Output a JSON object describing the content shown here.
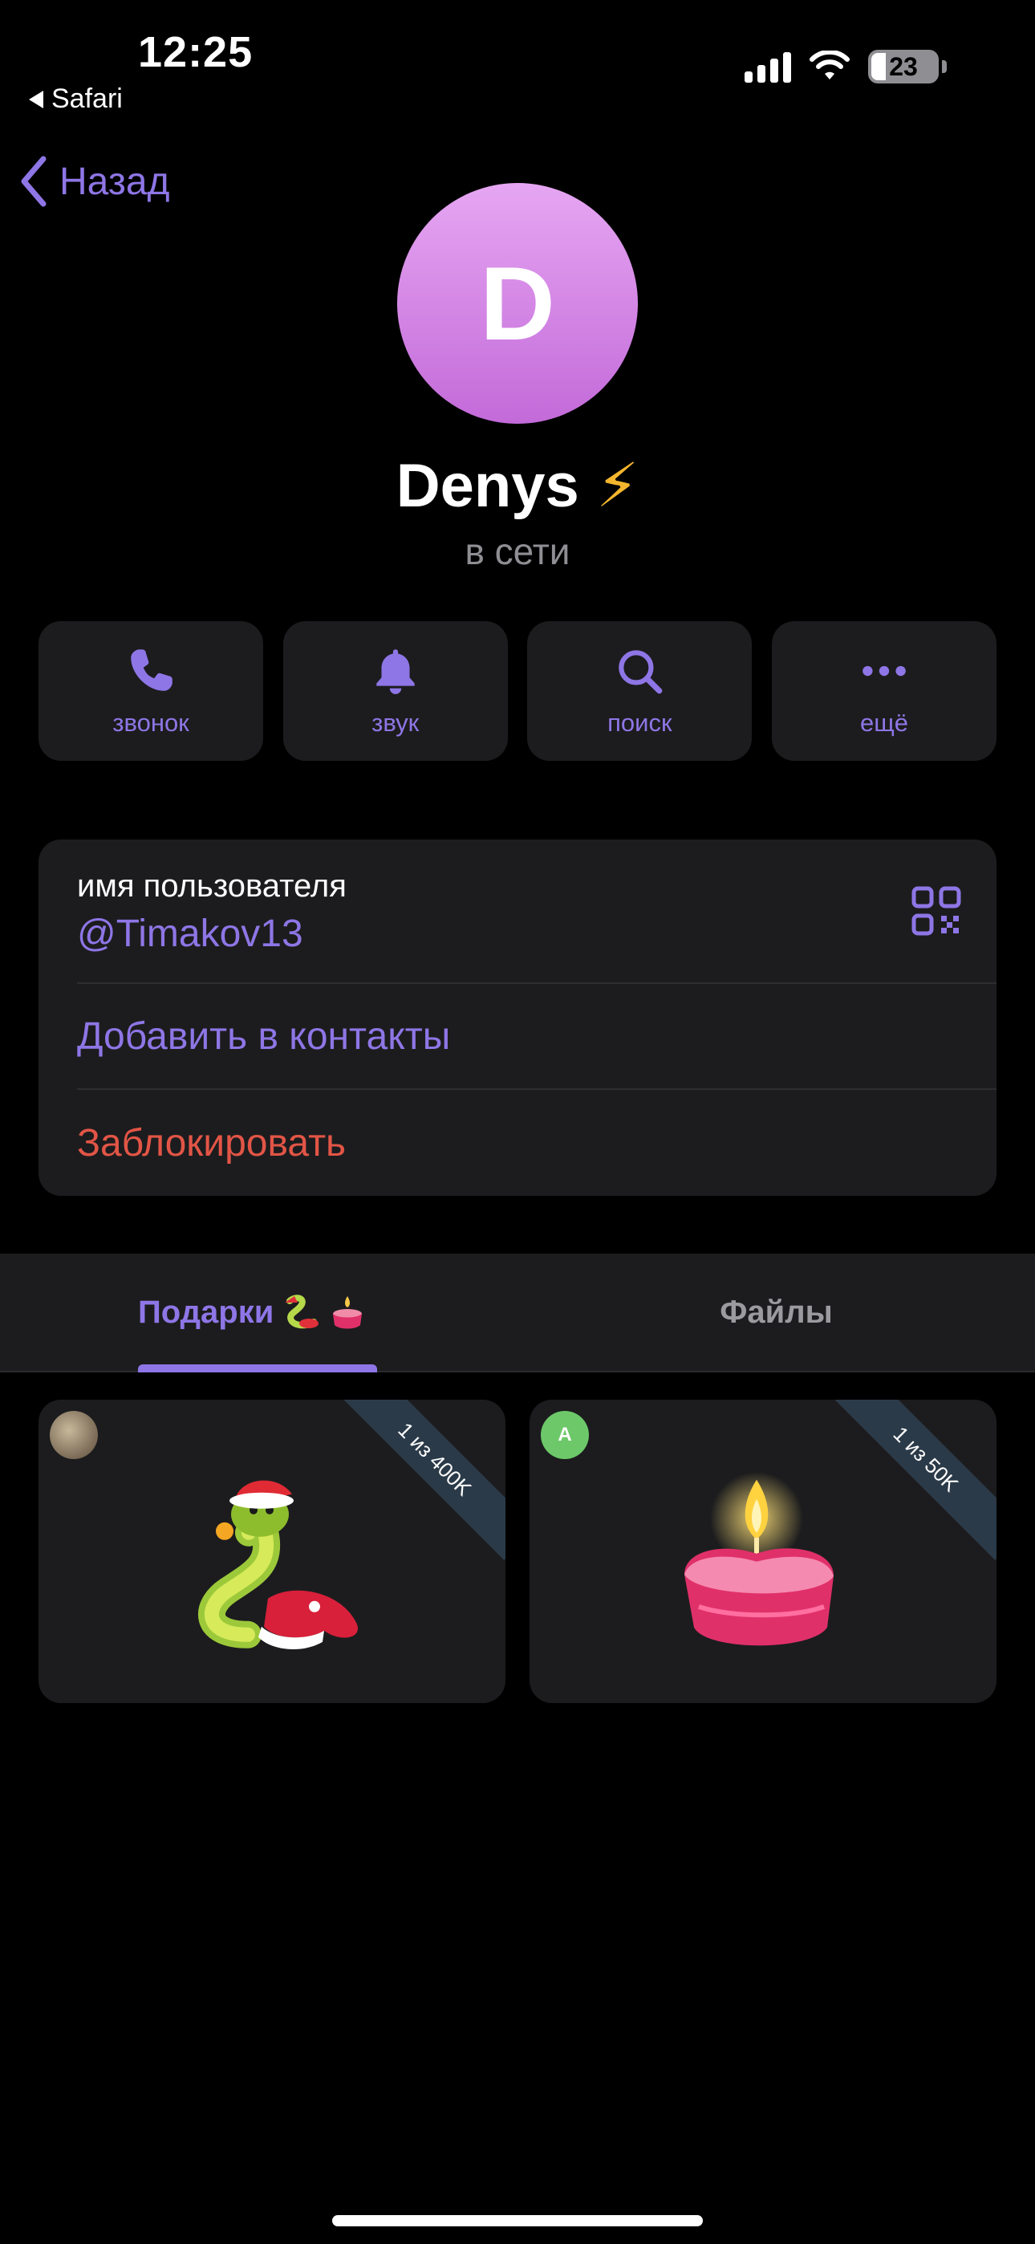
{
  "status_bar": {
    "time": "12:25",
    "back_app": "Safari",
    "battery": "23"
  },
  "nav": {
    "back_label": "Назад"
  },
  "profile": {
    "avatar_letter": "D",
    "name": "Denys",
    "name_emoji": "⚡",
    "status": "в сети",
    "avatar_gradient": [
      "#e6a6f2",
      "#c36ad9"
    ]
  },
  "actions": [
    {
      "label": "звонок",
      "icon": "phone-icon"
    },
    {
      "label": "звук",
      "icon": "bell-icon"
    },
    {
      "label": "поиск",
      "icon": "search-icon"
    },
    {
      "label": "ещё",
      "icon": "more-icon"
    }
  ],
  "info": {
    "username_title": "имя пользователя",
    "username": "@Timakov13",
    "add_contact": "Добавить в контакты",
    "block": "Заблокировать"
  },
  "tabs": {
    "gifts": "Подарки",
    "files": "Файлы"
  },
  "gifts": [
    {
      "ribbon": "1 из 400K",
      "sender_initial": "",
      "art": "snake-santa-hat"
    },
    {
      "ribbon": "1 из 50K",
      "sender_initial": "A",
      "art": "candle"
    }
  ],
  "colors": {
    "accent": "#8e76e6",
    "danger": "#e25546",
    "card": "#1c1c1e",
    "background": "#000000"
  }
}
